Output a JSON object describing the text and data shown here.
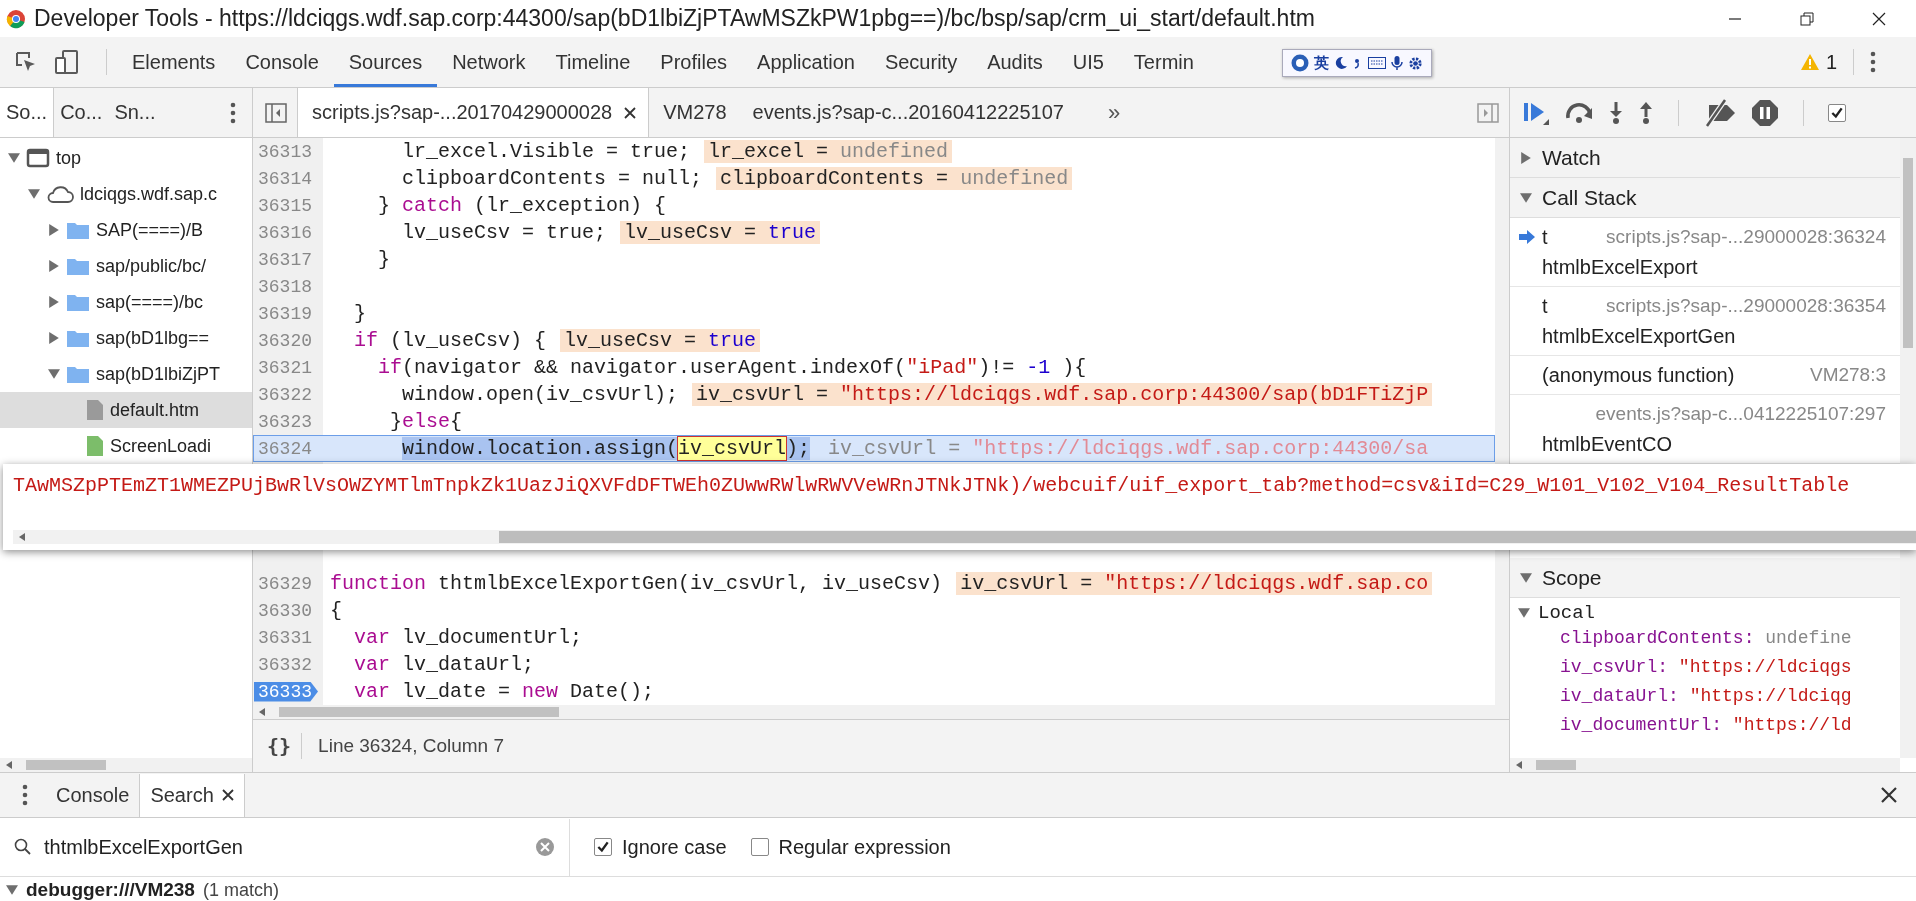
{
  "window": {
    "title": "Developer Tools - https://ldciqgs.wdf.sap.corp:44300/sap(bD1lbiZjPTAwMSZkPW1pbg==)/bc/bsp/sap/crm_ui_start/default.htm"
  },
  "panel_tabs": [
    {
      "label": "Elements",
      "selected": false
    },
    {
      "label": "Console",
      "selected": false
    },
    {
      "label": "Sources",
      "selected": true
    },
    {
      "label": "Network",
      "selected": false
    },
    {
      "label": "Timeline",
      "selected": false
    },
    {
      "label": "Profiles",
      "selected": false
    },
    {
      "label": "Application",
      "selected": false
    },
    {
      "label": "Security",
      "selected": false
    },
    {
      "label": "Audits",
      "selected": false
    },
    {
      "label": "UI5",
      "selected": false
    },
    {
      "label": "Termin",
      "selected": false
    }
  ],
  "ime_bar": {
    "label": "英"
  },
  "warnings": {
    "count": "1"
  },
  "navigator": {
    "tabs": [
      {
        "label": "So...",
        "selected": true
      },
      {
        "label": "Co...",
        "selected": false
      },
      {
        "label": "Sn...",
        "selected": false
      }
    ],
    "tree": [
      {
        "label": "top",
        "kind": "frame",
        "expanded": true,
        "selected": false,
        "children": [
          {
            "label": "ldciqgs.wdf.sap.c",
            "kind": "domain",
            "expanded": true,
            "selected": false,
            "children": [
              {
                "label": "SAP(====)/B",
                "kind": "folder",
                "expanded": false,
                "selected": false
              },
              {
                "label": "sap/public/bc/",
                "kind": "folder",
                "expanded": false,
                "selected": false
              },
              {
                "label": "sap(====)/bc",
                "kind": "folder",
                "expanded": false,
                "selected": false
              },
              {
                "label": "sap(bD1lbg==",
                "kind": "folder",
                "expanded": false,
                "selected": false
              },
              {
                "label": "sap(bD1lbiZjPT",
                "kind": "folder",
                "expanded": true,
                "selected": false,
                "children": [
                  {
                    "label": "default.htm",
                    "kind": "file",
                    "selected": true
                  },
                  {
                    "label": "ScreenLoadi",
                    "kind": "script",
                    "selected": false
                  }
                ]
              }
            ]
          }
        ]
      }
    ]
  },
  "editor": {
    "tabs": [
      {
        "label": "scripts.js?sap-...20170429000028",
        "selected": true,
        "closable": true
      },
      {
        "label": "VM278",
        "selected": false,
        "closable": false
      },
      {
        "label": "events.js?sap-c...20160412225107",
        "selected": false,
        "closable": false
      }
    ],
    "overflow": "»",
    "lines_above": [
      {
        "number": "36313",
        "segments": [
          {
            "text": "      lr_excel.Visible = true;",
            "kind": "plain"
          }
        ],
        "note": {
          "label": "lr_excel =",
          "value": "undefined",
          "kind": "undefined"
        },
        "current": false,
        "breakpoint": false
      },
      {
        "number": "36314",
        "segments": [
          {
            "text": "      clipboardContents = null;",
            "kind": "plain"
          }
        ],
        "note": {
          "label": "clipboardContents =",
          "value": "undefined",
          "kind": "undefined"
        },
        "current": false,
        "breakpoint": false
      },
      {
        "number": "36315",
        "segments": [
          {
            "text": "    } ",
            "kind": "plain"
          },
          {
            "text": "catch",
            "kind": "keyword"
          },
          {
            "text": " (lr_exception) {",
            "kind": "plain"
          }
        ],
        "current": false,
        "breakpoint": false
      },
      {
        "number": "36316",
        "segments": [
          {
            "text": "      lv_useCsv = true;",
            "kind": "plain"
          }
        ],
        "note": {
          "label": "lv_useCsv =",
          "value": "true",
          "kind": "boolean"
        },
        "current": false,
        "breakpoint": false
      },
      {
        "number": "36317",
        "segments": [
          {
            "text": "    }",
            "kind": "plain"
          }
        ],
        "current": false,
        "breakpoint": false
      },
      {
        "number": "36318",
        "current": false,
        "breakpoint": false
      },
      {
        "number": "36319",
        "segments": [
          {
            "text": "  }",
            "kind": "plain"
          }
        ],
        "current": false,
        "breakpoint": false
      },
      {
        "number": "36320",
        "segments": [
          {
            "text": "  if",
            "kind": "keyword"
          },
          {
            "text": " (lv_useCsv) {",
            "kind": "plain"
          }
        ],
        "note": {
          "label": "lv_useCsv =",
          "value": "true",
          "kind": "boolean"
        },
        "current": false,
        "breakpoint": false
      },
      {
        "number": "36321",
        "segments": [
          {
            "text": "    if",
            "kind": "keyword"
          },
          {
            "text": "(navigator && navigator.userAgent.indexOf(",
            "kind": "plain"
          },
          {
            "text": "\"iPad\"",
            "kind": "string"
          },
          {
            "text": ")!= ",
            "kind": "plain"
          },
          {
            "text": "-1",
            "kind": "number"
          },
          {
            "text": " ){",
            "kind": "plain"
          }
        ],
        "current": false,
        "breakpoint": false
      },
      {
        "number": "36322",
        "segments": [
          {
            "text": "      window.open(iv_csvUrl);",
            "kind": "plain"
          }
        ],
        "note": {
          "label": "iv_csvUrl =",
          "value": "\"https://ldciqgs.wdf.sap.corp:44300/sap(bD1FTiZjP",
          "kind": "string"
        },
        "current": false,
        "breakpoint": false
      },
      {
        "number": "36323",
        "segments": [
          {
            "text": "     }",
            "kind": "plain"
          },
          {
            "text": "else",
            "kind": "keyword"
          },
          {
            "text": "{",
            "kind": "plain"
          }
        ],
        "current": false,
        "breakpoint": false
      },
      {
        "number": "36324",
        "segments": [
          {
            "text": "      window.location.assign(",
            "kind": "selection"
          },
          {
            "text": "iv_csvUrl",
            "kind": "hover"
          },
          {
            "text": ");",
            "kind": "selection"
          }
        ],
        "note": {
          "label": "iv_csvUrl =",
          "value": "\"https://ldciqgs.wdf.sap.corp:44300/sa",
          "kind": "string"
        },
        "current": true,
        "breakpoint": false
      }
    ],
    "lines_below": [
      {
        "number": "36329",
        "segments": [
          {
            "text": "function",
            "kind": "keyword"
          },
          {
            "text": " thtmlbExcelExportGen(iv_csvUrl, iv_useCsv)",
            "kind": "plain"
          }
        ],
        "note": {
          "label": "iv_csvUrl =",
          "value": "\"https://ldciqgs.wdf.sap.co",
          "kind": "string"
        },
        "current": false,
        "breakpoint": false
      },
      {
        "number": "36330",
        "segments": [
          {
            "text": "{",
            "kind": "plain"
          }
        ],
        "current": false,
        "breakpoint": false
      },
      {
        "number": "36331",
        "segments": [
          {
            "text": "  var",
            "kind": "keyword"
          },
          {
            "text": " lv_documentUrl;",
            "kind": "plain"
          }
        ],
        "current": false,
        "breakpoint": false
      },
      {
        "number": "36332",
        "segments": [
          {
            "text": "  var",
            "kind": "keyword"
          },
          {
            "text": " lv_dataUrl;",
            "kind": "plain"
          }
        ],
        "current": false,
        "breakpoint": false
      },
      {
        "number": "36333",
        "segments": [
          {
            "text": "  var",
            "kind": "keyword"
          },
          {
            "text": " lv_date = ",
            "kind": "plain"
          },
          {
            "text": "new",
            "kind": "keyword"
          },
          {
            "text": " Date();",
            "kind": "plain"
          }
        ],
        "current": false,
        "breakpoint": true
      }
    ],
    "status": {
      "format_icon": "{}",
      "position": "Line 36324, Column 7"
    }
  },
  "tooltip": {
    "text": "TAwMSZpPTEmZT1WMEZPUjBwRlVsOWZYMTlmTnpkZk1UazJiQXVFdDFTWEh0ZUwwRWlwRWVVeWRnJTNkJTNk)/webcuif/uif_export_tab?method=csv&iId=C29_W101_V102_V104_ResultTable"
  },
  "debugger": {
    "async_checked": true,
    "watch": {
      "title": "Watch",
      "expanded": false
    },
    "call_stack": {
      "title": "Call Stack",
      "expanded": true,
      "frames": [
        {
          "title": "t",
          "location": "scripts.js?sap-...29000028:36324",
          "title_cont": "htmlbExcelExport",
          "current": true
        },
        {
          "title": "t",
          "location": "scripts.js?sap-...29000028:36354",
          "title_cont": "htmlbExcelExportGen",
          "current": false
        },
        {
          "title": "(anonymous function)",
          "location": "VM278:3",
          "current": false
        },
        {
          "location": "events.js?sap-c...0412225107:297",
          "title_cont": "htmlbEventCO",
          "current": false
        }
      ]
    },
    "scope": {
      "title": "Scope",
      "expanded": true,
      "groups": [
        {
          "title": "Local",
          "expanded": true,
          "vars": [
            {
              "name": "clipboardContents:",
              "value": "undefine",
              "kind": "undefined"
            },
            {
              "name": "iv_csvUrl:",
              "value": "\"https://ldciqgs",
              "kind": "string"
            },
            {
              "name": "iv_dataUrl:",
              "value": "\"https://ldciqg",
              "kind": "string"
            },
            {
              "name": "iv_documentUrl:",
              "value": "\"https://ld",
              "kind": "string"
            }
          ]
        }
      ]
    }
  },
  "drawer": {
    "tabs": [
      {
        "label": "Console",
        "selected": false,
        "closable": false
      },
      {
        "label": "Search",
        "selected": true,
        "closable": true
      }
    ],
    "search": {
      "value": "thtmlbExcelExportGen"
    },
    "options": [
      {
        "label": "Ignore case",
        "checked": true
      },
      {
        "label": "Regular expression",
        "checked": false
      }
    ],
    "results": [
      {
        "file": "debugger:///VM238",
        "count": "(1 match)",
        "expanded": true
      }
    ]
  }
}
